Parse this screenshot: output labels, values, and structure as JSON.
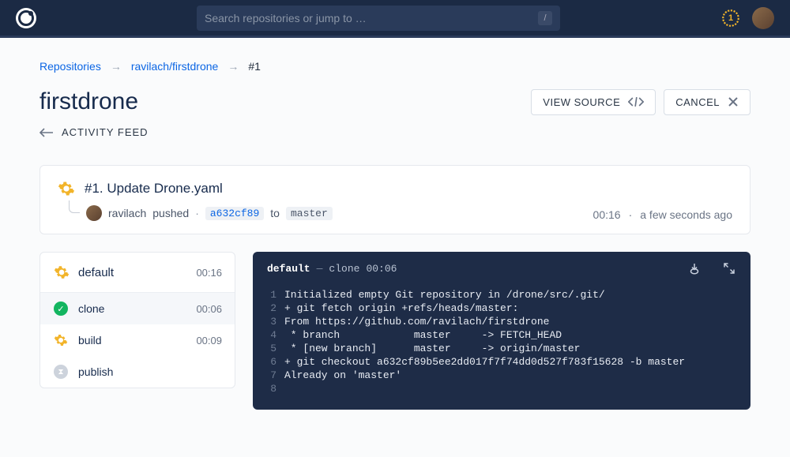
{
  "header": {
    "search_placeholder": "Search repositories or jump to …",
    "slash": "/",
    "badge_count": "1"
  },
  "breadcrumb": {
    "repos": "Repositories",
    "path": "ravilach/firstdrone",
    "current": "#1"
  },
  "page": {
    "title": "firstdrone",
    "view_source": "VIEW SOURCE",
    "cancel": "CANCEL",
    "activity_feed": "ACTIVITY FEED"
  },
  "build": {
    "title": "#1. Update Drone.yaml",
    "author": "ravilach",
    "verb": "pushed",
    "commit": "a632cf89",
    "to": "to",
    "branch": "master",
    "duration": "00:16",
    "when_sep": "·",
    "when": "a few seconds ago"
  },
  "stage": {
    "name": "default",
    "duration": "00:16",
    "steps": [
      {
        "status": "success",
        "name": "clone",
        "time": "00:06"
      },
      {
        "status": "running",
        "name": "build",
        "time": "00:09"
      },
      {
        "status": "pending",
        "name": "publish",
        "time": ""
      }
    ]
  },
  "log": {
    "stage_name": "default",
    "step_name": "clone",
    "step_time": "00:06",
    "lines": [
      "Initialized empty Git repository in /drone/src/.git/",
      "+ git fetch origin +refs/heads/master:",
      "From https://github.com/ravilach/firstdrone",
      " * branch            master     -> FETCH_HEAD",
      " * [new branch]      master     -> origin/master",
      "+ git checkout a632cf89b5ee2dd017f7f74dd0d527f783f15628 -b master",
      "Already on 'master'",
      ""
    ]
  }
}
